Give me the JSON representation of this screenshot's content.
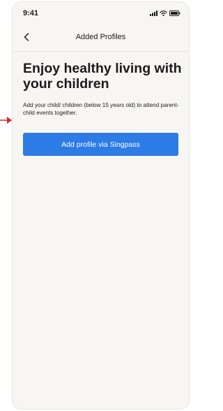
{
  "status_bar": {
    "time": "9:41",
    "icons": [
      "cellular-signal-icon",
      "wifi-icon",
      "battery-icon"
    ]
  },
  "nav": {
    "back_icon": "chevron-left-icon",
    "title": "Added Profiles"
  },
  "content": {
    "heading": "Enjoy healthy living with your children",
    "description": "Add your child/ children (below 15 years old) to attend parent-child events together.",
    "cta_label": "Add profile via Singpass"
  },
  "annotation": {
    "pointer_icon": "red-arrow-icon"
  },
  "colors": {
    "background": "#f7f6f3",
    "primary_button": "#2d7be5",
    "text": "#1b1b1b",
    "annotation_arrow": "#e0252b"
  }
}
